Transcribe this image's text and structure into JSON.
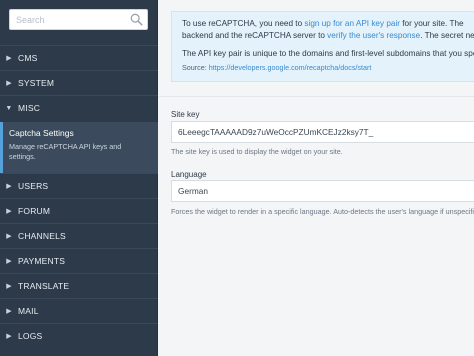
{
  "sidebar": {
    "search": {
      "placeholder": "Search",
      "value": ""
    },
    "items_before": [
      {
        "label": "CMS",
        "expanded": false
      },
      {
        "label": "SYSTEM",
        "expanded": false
      },
      {
        "label": "MISC",
        "expanded": true
      }
    ],
    "active_item": {
      "title": "Captcha Settings",
      "description": "Manage reCAPTCHA API keys and settings."
    },
    "items_after": [
      {
        "label": "USERS"
      },
      {
        "label": "FORUM"
      },
      {
        "label": "CHANNELS"
      },
      {
        "label": "PAYMENTS"
      },
      {
        "label": "TRANSLATE"
      },
      {
        "label": "MAIL"
      },
      {
        "label": "LOGS"
      }
    ]
  },
  "info": {
    "line1_text": "To use reCAPTCHA, you need to ",
    "line1_link": "sign up for an API key pair",
    "line1_tail": " for your site. The",
    "line2_text": "backend and the reCAPTCHA server to ",
    "line2_link": "verify the user's response",
    "line2_tail": ". The secret ne",
    "line3_text": "The API key pair is unique to the domains and first-level subdomains that you spe",
    "source_label": "Source: ",
    "source_link": "https://developers.google.com/recaptcha/docs/start"
  },
  "site_key": {
    "label": "Site key",
    "value": "6LeeegcTAAAAAD9z7uWeOccPZUmKCEJz2ksy7T_",
    "help": "The site key is used to display the widget on your site."
  },
  "language": {
    "label": "Language",
    "value": "German",
    "help": "Forces the widget to render in a specific language. Auto-detects the user's language if unspecifie"
  }
}
